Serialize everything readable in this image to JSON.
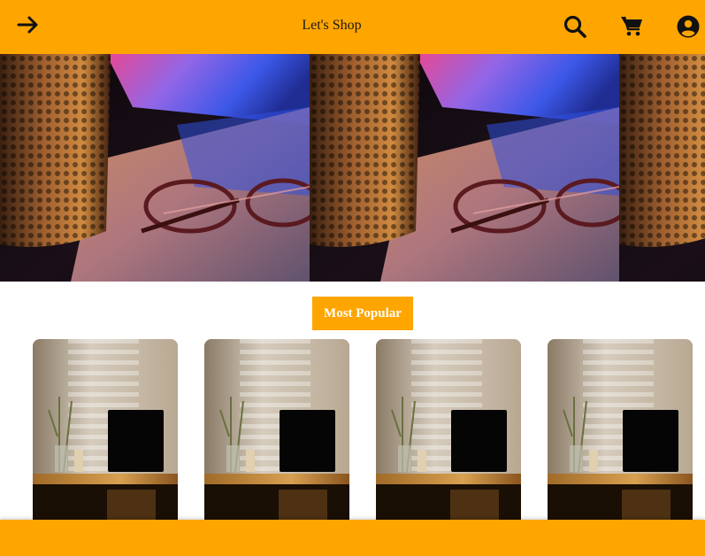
{
  "header": {
    "title": "Let's Shop",
    "back_icon": "arrow-right-icon",
    "search_icon": "search-icon",
    "cart_icon": "cart-icon",
    "user_icon": "user-circle-icon"
  },
  "banner": {
    "image": "coffee-cup-glasses-laptop-photo",
    "tiles": 3
  },
  "section": {
    "title": "Most Popular"
  },
  "products": [
    {
      "image": "desk-laptop-plant-photo"
    },
    {
      "image": "desk-laptop-plant-photo"
    },
    {
      "image": "desk-laptop-plant-photo"
    },
    {
      "image": "desk-laptop-plant-photo"
    }
  ],
  "colors": {
    "accent": "#ffa500",
    "title_text": "#ffffff",
    "header_text": "#1a1a1a"
  }
}
